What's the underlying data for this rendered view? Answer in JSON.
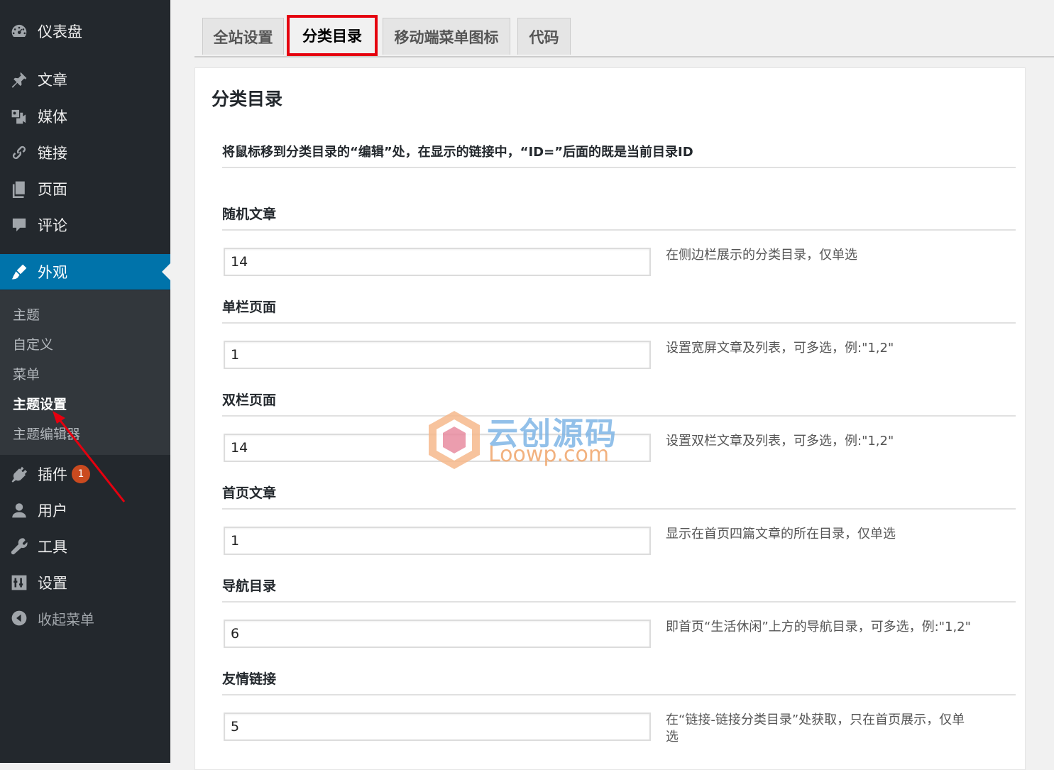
{
  "sidebar": {
    "menu": [
      {
        "label": "仪表盘",
        "icon": "dashboard-icon"
      },
      {
        "label": "文章",
        "icon": "pin-icon"
      },
      {
        "label": "媒体",
        "icon": "media-icon"
      },
      {
        "label": "链接",
        "icon": "link-icon"
      },
      {
        "label": "页面",
        "icon": "page-icon"
      },
      {
        "label": "评论",
        "icon": "comment-icon"
      },
      {
        "label": "外观",
        "icon": "brush-icon",
        "active": true
      },
      {
        "label": "插件",
        "icon": "plugin-icon",
        "badge": "1"
      },
      {
        "label": "用户",
        "icon": "user-icon"
      },
      {
        "label": "工具",
        "icon": "wrench-icon"
      },
      {
        "label": "设置",
        "icon": "settings-icon"
      },
      {
        "label": "收起菜单",
        "icon": "collapse-icon"
      }
    ],
    "submenu": [
      {
        "label": "主题"
      },
      {
        "label": "自定义"
      },
      {
        "label": "菜单"
      },
      {
        "label": "主题设置",
        "current": true
      },
      {
        "label": "主题编辑器"
      }
    ]
  },
  "tabs": [
    {
      "label": "全站设置"
    },
    {
      "label": "分类目录",
      "active": true
    },
    {
      "label": "移动端菜单图标"
    },
    {
      "label": "代码"
    }
  ],
  "panel": {
    "title": "分类目录",
    "intro": "将鼠标移到分类目录的“编辑”处，在显示的链接中，“ID=”后面的既是当前目录ID",
    "fields": [
      {
        "label": "随机文章",
        "value": "14",
        "desc": "在侧边栏展示的分类目录，仅单选"
      },
      {
        "label": "单栏页面",
        "value": "1",
        "desc": "设置宽屏文章及列表，可多选，例:\"1,2\""
      },
      {
        "label": "双栏页面",
        "value": "14",
        "desc": "设置双栏文章及列表，可多选，例:\"1,2\""
      },
      {
        "label": "首页文章",
        "value": "1",
        "desc": "显示在首页四篇文章的所在目录，仅单选"
      },
      {
        "label": "导航目录",
        "value": "6",
        "desc": "即首页“生活休闲”上方的导航目录，可多选，例:\"1,2\""
      },
      {
        "label": "友情链接",
        "value": "5",
        "desc": "在“链接-链接分类目录”处获取，只在首页展示，仅单选"
      }
    ]
  },
  "watermark": {
    "title": "云创源码",
    "subtitle": "Loowp.com"
  },
  "colors": {
    "sidebar_bg": "#23282d",
    "active_bg": "#0073aa",
    "highlight_border": "#e5000f",
    "badge": "#ca4a1f"
  }
}
